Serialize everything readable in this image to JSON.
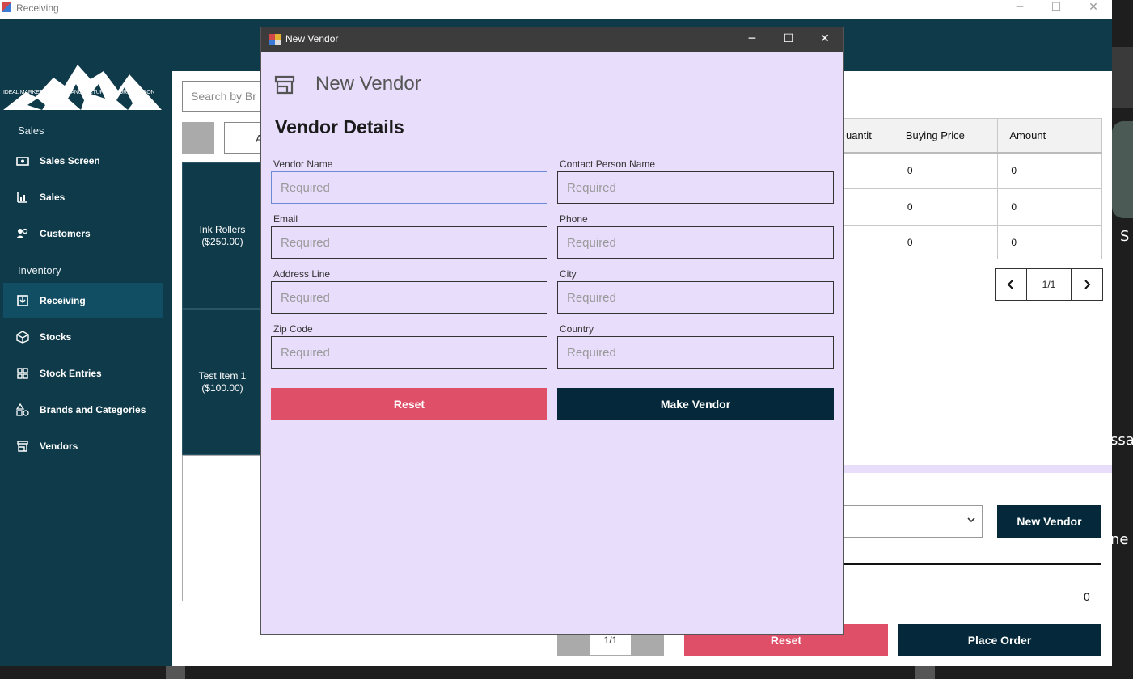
{
  "app": {
    "title": "Receiving",
    "minimize": "─",
    "maximize": "☐",
    "close": "✕"
  },
  "sidebar": {
    "logo_text": "IDEAL MARKETING AND MANUFACTURING CORPORATION",
    "sections": {
      "sales": "Sales",
      "inventory": "Inventory"
    },
    "items": [
      {
        "label": "Sales Screen",
        "icon": "cash-register-icon"
      },
      {
        "label": "Sales",
        "icon": "chart-icon"
      },
      {
        "label": "Customers",
        "icon": "people-icon"
      },
      {
        "label": "Receiving",
        "icon": "receiving-box-icon",
        "active": true
      },
      {
        "label": "Stocks",
        "icon": "cube-icon"
      },
      {
        "label": "Stock Entries",
        "icon": "grid-icon"
      },
      {
        "label": "Brands and Categories",
        "icon": "shapes-icon"
      },
      {
        "label": "Vendors",
        "icon": "store-icon"
      }
    ]
  },
  "content": {
    "search_placeholder": "Search by Br",
    "filter_label": "A",
    "items": [
      {
        "name": "Ink Rollers",
        "price": "($250.00)"
      },
      {
        "name": "Test Item 1",
        "price": "($100.00)"
      }
    ],
    "bottom_page": "1/1"
  },
  "order": {
    "columns": [
      "uantit",
      "Buying Price",
      "Amount"
    ],
    "rows": [
      [
        "",
        "0",
        "0"
      ],
      [
        "",
        "0",
        "0"
      ],
      [
        "",
        "0",
        "0"
      ]
    ],
    "page": "1/1",
    "prev": "‹",
    "next": "›",
    "new_vendor_label": "New Vendor",
    "total": "0",
    "reset_label": "Reset",
    "place_order_label": "Place Order"
  },
  "modal": {
    "title": "New Vendor",
    "header": "New Vendor",
    "section": "Vendor Details",
    "fields": {
      "vendor_name": {
        "label": "Vendor Name",
        "placeholder": "Required"
      },
      "contact_person": {
        "label": "Contact Person Name",
        "placeholder": "Required"
      },
      "email": {
        "label": "Email",
        "placeholder": "Required"
      },
      "phone": {
        "label": "Phone",
        "placeholder": "Required"
      },
      "address": {
        "label": "Address Line",
        "placeholder": "Required"
      },
      "city": {
        "label": "City",
        "placeholder": "Required"
      },
      "zip": {
        "label": "Zip Code",
        "placeholder": "Required"
      },
      "country": {
        "label": "Country",
        "placeholder": "Required"
      }
    },
    "reset_label": "Reset",
    "make_label": "Make Vendor"
  },
  "desktop": {
    "side_text_1": "S",
    "side_text_2": "ssa",
    "side_text_3": "ne"
  },
  "colors": {
    "sidebar": "#0f3a4a",
    "active": "#114e63",
    "modal_bg": "#e8ddfb",
    "dark_button": "#05293a",
    "red_button": "#df4f68"
  }
}
